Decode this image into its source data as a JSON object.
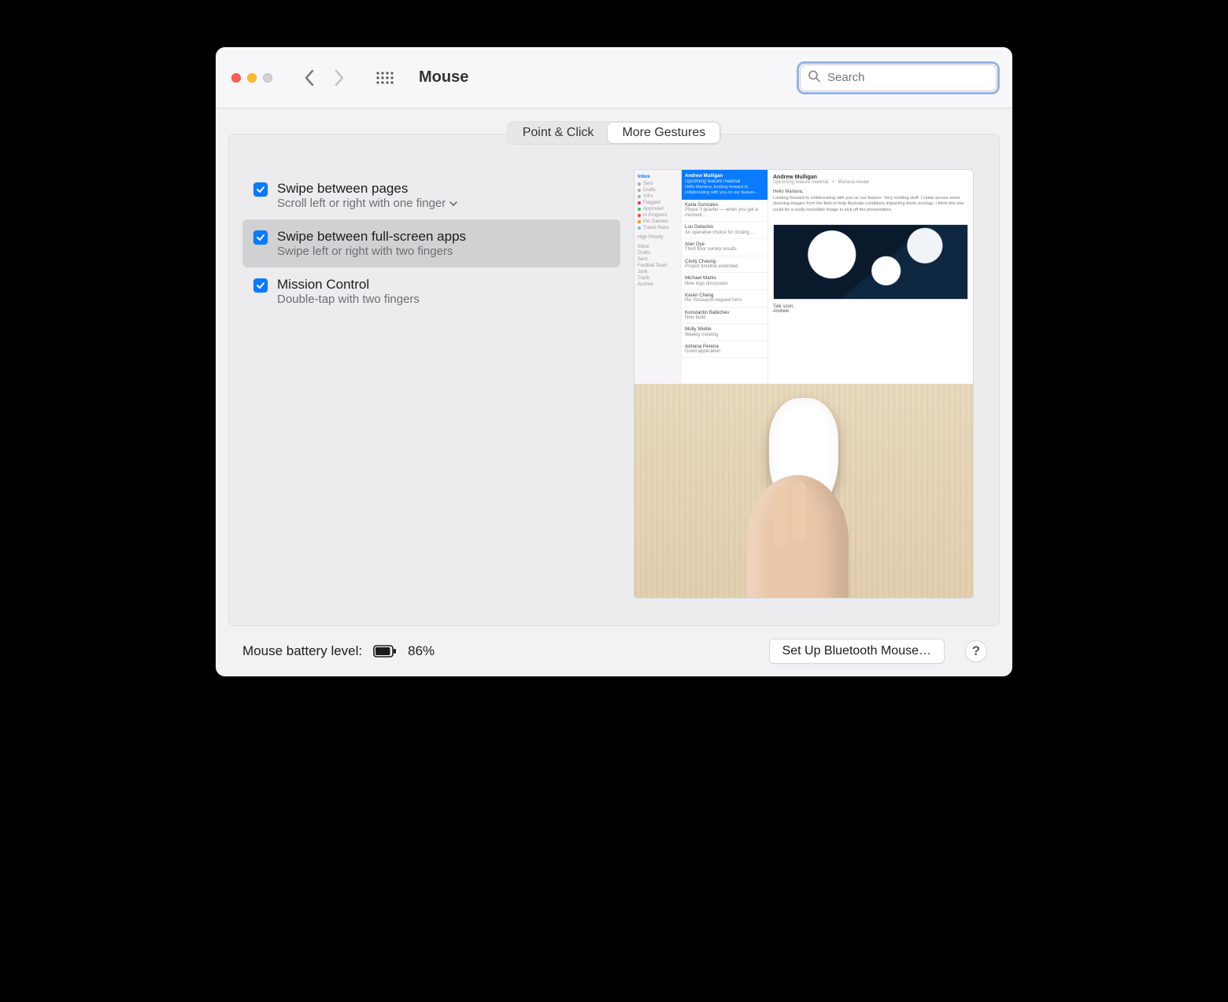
{
  "window": {
    "title": "Mouse",
    "search_placeholder": "Search"
  },
  "tabs": {
    "point_click": "Point & Click",
    "more_gestures": "More Gestures",
    "active": "more_gestures"
  },
  "options": [
    {
      "id": "swipe-pages",
      "checked": true,
      "selected": false,
      "title": "Swipe between pages",
      "subtitle": "Scroll left or right with one finger",
      "has_submenu": true
    },
    {
      "id": "swipe-fullscreen",
      "checked": true,
      "selected": true,
      "title": "Swipe between full-screen apps",
      "subtitle": "Swipe left or right with two fingers",
      "has_submenu": false
    },
    {
      "id": "mission-control",
      "checked": true,
      "selected": false,
      "title": "Mission Control",
      "subtitle": "Double-tap with two fingers",
      "has_submenu": false
    }
  ],
  "footer": {
    "battery_label": "Mouse battery level:",
    "battery_percent": "86%",
    "setup_button": "Set Up Bluetooth Mouse…",
    "help": "?"
  }
}
